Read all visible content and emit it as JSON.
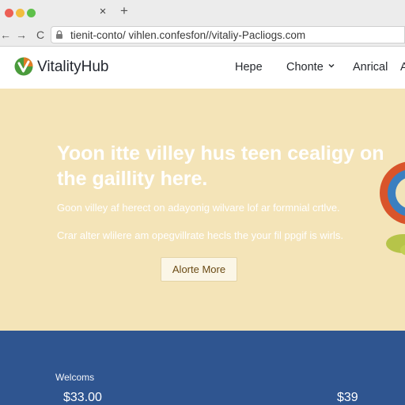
{
  "browser": {
    "tab_close": "×",
    "tab_new": "+",
    "nav": {
      "back": "←",
      "forward": "→",
      "reload": "C"
    },
    "url": "tienit-conto/ vihlen.confesfon//vitaliy-Pacliogs.com"
  },
  "header": {
    "brand": "VitalityHub",
    "nav": [
      {
        "label": "Hepe"
      },
      {
        "label": "Chonte"
      },
      {
        "label": "Anrical"
      },
      {
        "label": "A"
      }
    ],
    "colors": {
      "logo_green": "#4a9b3c",
      "logo_orange": "#e07b24"
    }
  },
  "hero": {
    "title": "Yoon itte villey hus teen cealigy on the gaillity here.",
    "body_1": "Goon villey af herect on adayonig wilvare lof ar formnial crtlve.",
    "body_2": "Crar alter wlilere am opegvillrate hecls the your fil ppgif is wirls.",
    "cta_label": "Alorte More",
    "background": "#f4e4b8"
  },
  "footer_band": {
    "welcome": "Welcoms",
    "price_left": "$33.00",
    "price_right": "$39",
    "background": "#2f5590"
  }
}
